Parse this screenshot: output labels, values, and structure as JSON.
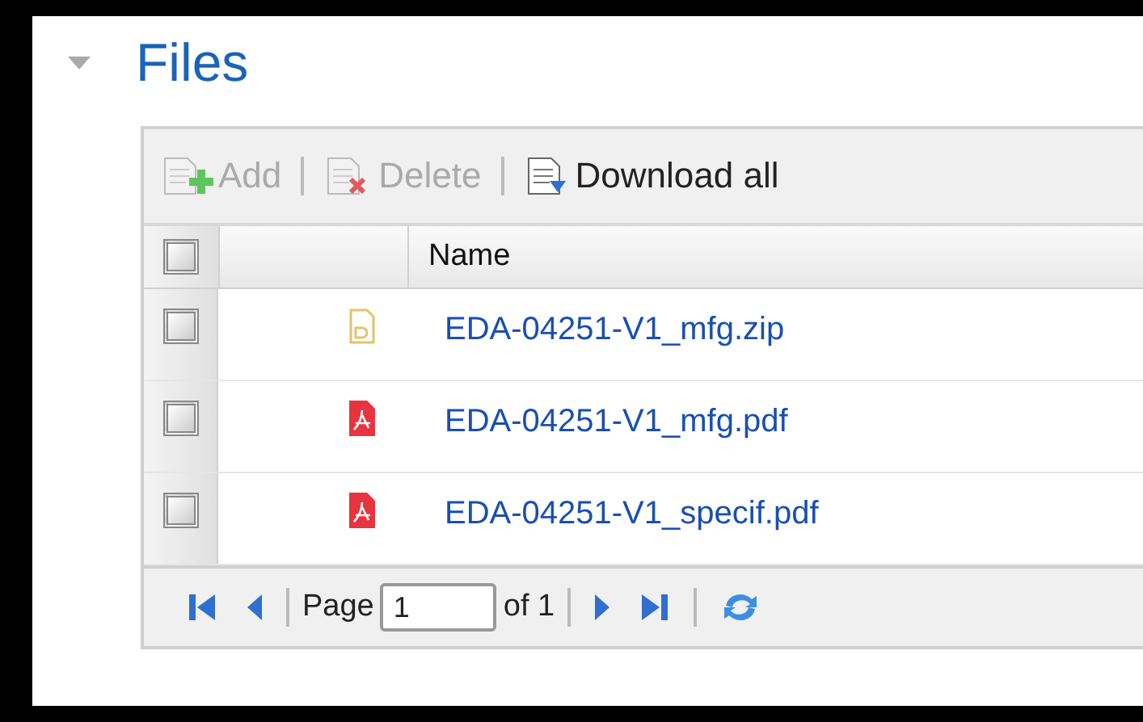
{
  "section": {
    "title": "Files",
    "expanded": true
  },
  "toolbar": [
    {
      "label": "Add",
      "kind": "add",
      "disabled": true
    },
    {
      "label": "Delete",
      "kind": "delete",
      "disabled": true
    },
    {
      "label": "Download all",
      "kind": "download",
      "disabled": false
    }
  ],
  "table": {
    "select_all": {
      "checked": false
    },
    "columns": [
      "Name"
    ],
    "rows": [
      {
        "name": "EDA-04251-V1_mfg.zip",
        "kind": "zip",
        "checked": false
      },
      {
        "name": "EDA-04251-V1_mfg.pdf",
        "kind": "pdf",
        "checked": false
      },
      {
        "name": "EDA-04251-V1_specif.pdf",
        "kind": "pdf",
        "checked": false
      }
    ]
  },
  "pager": {
    "page_label": "Page",
    "page_value": "1",
    "of_label": "of 1"
  }
}
